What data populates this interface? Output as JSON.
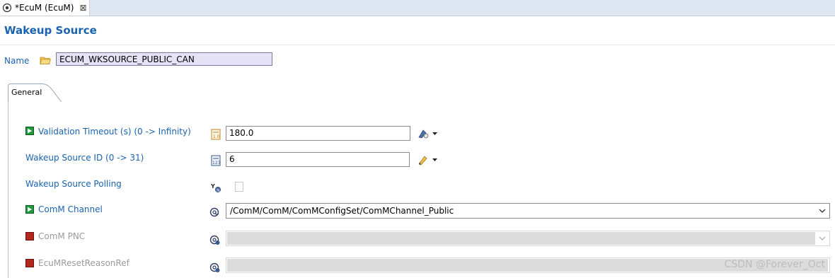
{
  "tab": {
    "title": "*EcuM (EcuM)",
    "close": "⊠"
  },
  "header": {
    "title": "Wakeup Source"
  },
  "name_row": {
    "label": "Name",
    "value": "ECUM_WKSOURCE_PUBLIC_CAN"
  },
  "general_tab": {
    "label": "General"
  },
  "rows": [
    {
      "label": "Validation Timeout (s) (0 -> Infinity)",
      "value": "180.0",
      "status_color": "#1f9a3c"
    },
    {
      "label": "Wakeup Source ID (0 -> 31)",
      "value": "6"
    },
    {
      "label": "Wakeup Source Polling",
      "checked": false
    },
    {
      "label": "ComM Channel",
      "value": "/ComM/ComM/ComMConfigSet/ComMChannel_Public",
      "status_color": "#1f9a3c"
    },
    {
      "label": "ComM PNC",
      "value": "",
      "status_color": "#b3261e"
    },
    {
      "label": "EcuMResetReasonRef",
      "value": "",
      "status_color": "#b3261e"
    }
  ],
  "watermark": "CSDN @Forever_Oct",
  "colors": {
    "title_blue": "#1a63b0",
    "disabled_gray": "#9b9b9b",
    "name_field_bg": "#e6e3f7"
  }
}
